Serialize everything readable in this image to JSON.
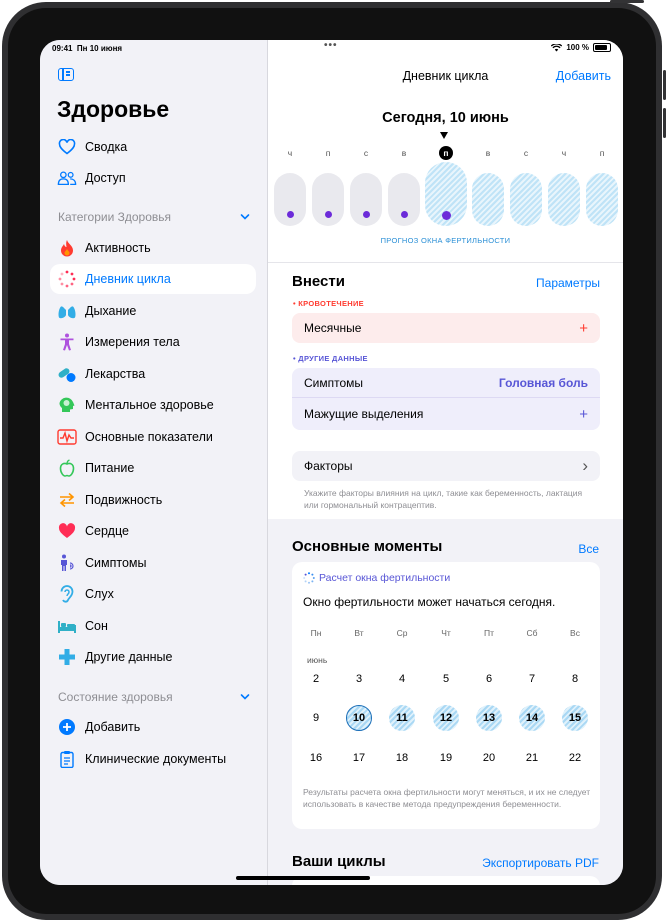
{
  "status_bar": {
    "time": "09:41",
    "date": "Пн 10 июня",
    "battery": "100 %"
  },
  "sidebar": {
    "title": "Здоровье",
    "top_items": [
      {
        "label": "Сводка",
        "icon": "heart-outline-icon"
      },
      {
        "label": "Доступ",
        "icon": "people-icon"
      }
    ],
    "categories_header": "Категории Здоровья",
    "categories": [
      {
        "label": "Активность",
        "icon": "flame-icon",
        "color": "#ff3b30"
      },
      {
        "label": "Дневник цикла",
        "icon": "cycle-icon",
        "color": "#ff2d55",
        "active": true
      },
      {
        "label": "Дыхание",
        "icon": "lungs-icon",
        "color": "#32ade6"
      },
      {
        "label": "Измерения тела",
        "icon": "figure-icon",
        "color": "#af52de"
      },
      {
        "label": "Лекарства",
        "icon": "pills-icon",
        "color": "#30b0c7"
      },
      {
        "label": "Ментальное здоровье",
        "icon": "head-icon",
        "color": "#34c759"
      },
      {
        "label": "Основные показатели",
        "icon": "waveform-icon",
        "color": "#ff3b30"
      },
      {
        "label": "Питание",
        "icon": "apple-icon",
        "color": "#34c759"
      },
      {
        "label": "Подвижность",
        "icon": "arrows-icon",
        "color": "#ff9500"
      },
      {
        "label": "Сердце",
        "icon": "heart-icon",
        "color": "#ff2d55"
      },
      {
        "label": "Симптомы",
        "icon": "symptoms-figure-icon",
        "color": "#5856d6"
      },
      {
        "label": "Слух",
        "icon": "ear-icon",
        "color": "#32ade6"
      },
      {
        "label": "Сон",
        "icon": "bed-icon",
        "color": "#30b0c7"
      },
      {
        "label": "Другие данные",
        "icon": "plus-cross-icon",
        "color": "#32ade6"
      }
    ],
    "health_state_header": "Состояние здоровья",
    "health_items": [
      {
        "label": "Добавить",
        "icon": "add-circle-icon"
      },
      {
        "label": "Клинические документы",
        "icon": "clipboard-icon"
      }
    ]
  },
  "main": {
    "nav_title": "Дневник цикла",
    "add_label": "Добавить",
    "date_title": "Сегодня, 10 июнь",
    "week_letters": [
      "ч",
      "п",
      "с",
      "в",
      "п",
      "в",
      "с",
      "ч",
      "п"
    ],
    "fertility_caption": "ПРОГНОЗ ОКНА ФЕРТИЛЬНОСТИ",
    "log": {
      "title": "Внести",
      "params_label": "Параметры",
      "bleeding_label": "• КРОВОТЕЧЕНИЕ",
      "period_label": "Месячные",
      "other_label": "• ДРУГИЕ ДАННЫЕ",
      "symptoms_label": "Симптомы",
      "symptoms_value": "Головная боль",
      "spotting_label": "Мажущие выделения",
      "plus": "+",
      "factors_label": "Факторы",
      "chevron": "›",
      "factors_note": "Укажите факторы влияния на цикл, такие как беременность, лактация или гормональный контрацептив."
    },
    "highlights": {
      "title": "Основные моменты",
      "all_label": "Все",
      "card_title": "Расчет окна фертильности",
      "card_text": "Окно фертильности может начаться сегодня.",
      "weekdays": [
        "Пн",
        "Вт",
        "Ср",
        "Чт",
        "Пт",
        "Сб",
        "Вс"
      ],
      "month": "июнь",
      "weeks": [
        [
          "2",
          "3",
          "4",
          "5",
          "6",
          "7",
          "8"
        ],
        [
          "9",
          "10",
          "11",
          "12",
          "13",
          "14",
          "15"
        ],
        [
          "16",
          "17",
          "18",
          "19",
          "20",
          "21",
          "22"
        ]
      ],
      "disclaimer": "Результаты расчета окна фертильности могут меняться, и их не следует использовать в качестве метода предупреждения беременности."
    },
    "cycles": {
      "title": "Ваши циклы",
      "export_label": "Экспортировать PDF"
    }
  }
}
